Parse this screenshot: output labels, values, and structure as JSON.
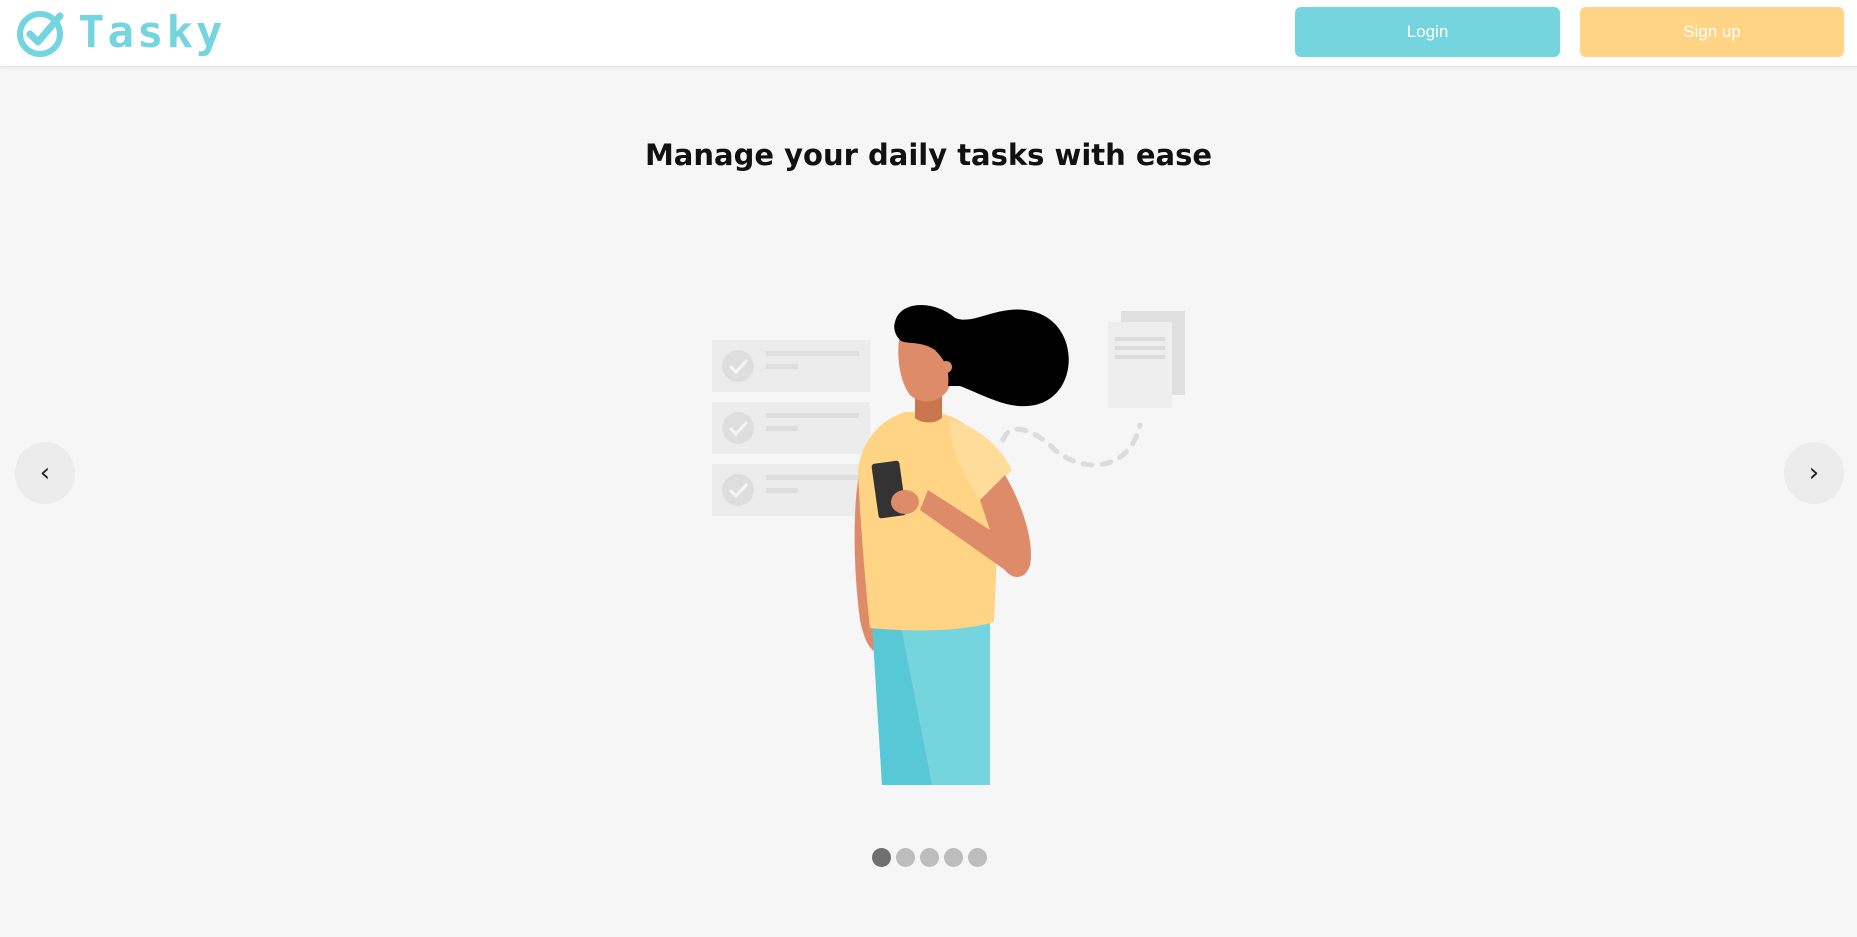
{
  "header": {
    "logo_text": "Tasky",
    "login_label": "Login",
    "signup_label": "Sign up"
  },
  "carousel": {
    "title": "Manage your daily tasks with ease",
    "prev_label": "‹",
    "next_label": "›",
    "slide_count": 5,
    "active_slide": 1
  },
  "colors": {
    "accent": "#74d5df",
    "secondary": "#ffd485",
    "background": "#f6f6f6"
  },
  "icons": [
    "check-circle-icon",
    "chevron-left-icon",
    "chevron-right-icon"
  ]
}
